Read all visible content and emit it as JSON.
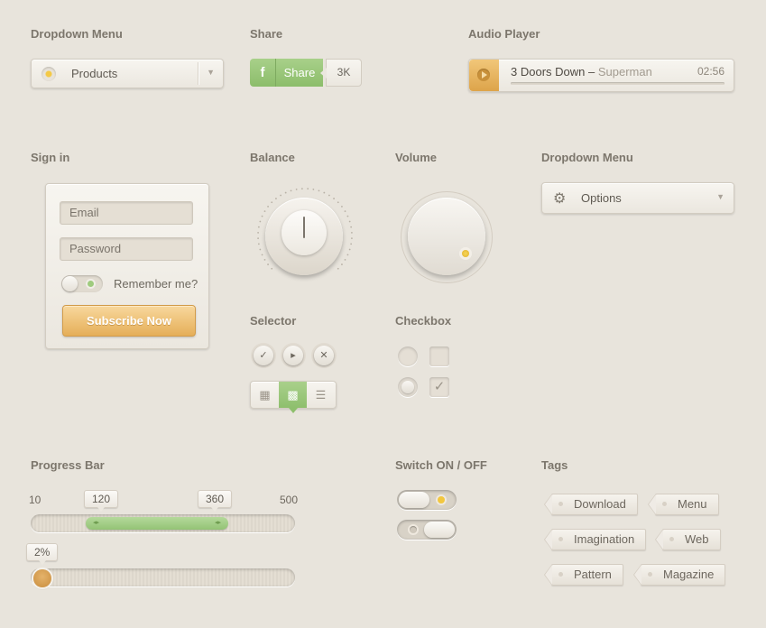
{
  "sections": {
    "dropdown1": "Dropdown Menu",
    "share": "Share",
    "audio": "Audio Player",
    "signin": "Sign in",
    "balance": "Balance",
    "volume": "Volume",
    "dropdown2": "Dropdown Menu",
    "selector": "Selector",
    "checkbox": "Checkbox",
    "progress": "Progress Bar",
    "switch": "Switch ON / OFF",
    "tags": "Tags"
  },
  "dropdown1": {
    "value": "Products",
    "arrow": "▼"
  },
  "share": {
    "icon": "f",
    "label": "Share",
    "count": "3K"
  },
  "audio": {
    "artist": "3 Doors Down",
    "separator": " – ",
    "song": "Superman",
    "time": "02:56"
  },
  "signin": {
    "email_placeholder": "Email",
    "password_placeholder": "Password",
    "remember_label": "Remember me?",
    "submit_label": "Subscribe Now"
  },
  "dropdown2": {
    "value": "Options",
    "gear": "⚙",
    "arrow": "▼"
  },
  "selector": {
    "round_buttons": [
      "✓",
      "▸",
      "✕"
    ],
    "segments": [
      "▦",
      "▩",
      "☰"
    ]
  },
  "progress": {
    "min": "10",
    "max": "500",
    "low": "120",
    "high": "360",
    "percent": "2%",
    "range_marks": "◂▸"
  },
  "tags": [
    "Download",
    "Menu",
    "Imagination",
    "Web",
    "Pattern",
    "Magazine"
  ],
  "colors": {
    "background": "#e8e4dc",
    "accent_green": "#93c375",
    "accent_orange": "#e5ae58",
    "led_yellow": "#f4c945"
  }
}
